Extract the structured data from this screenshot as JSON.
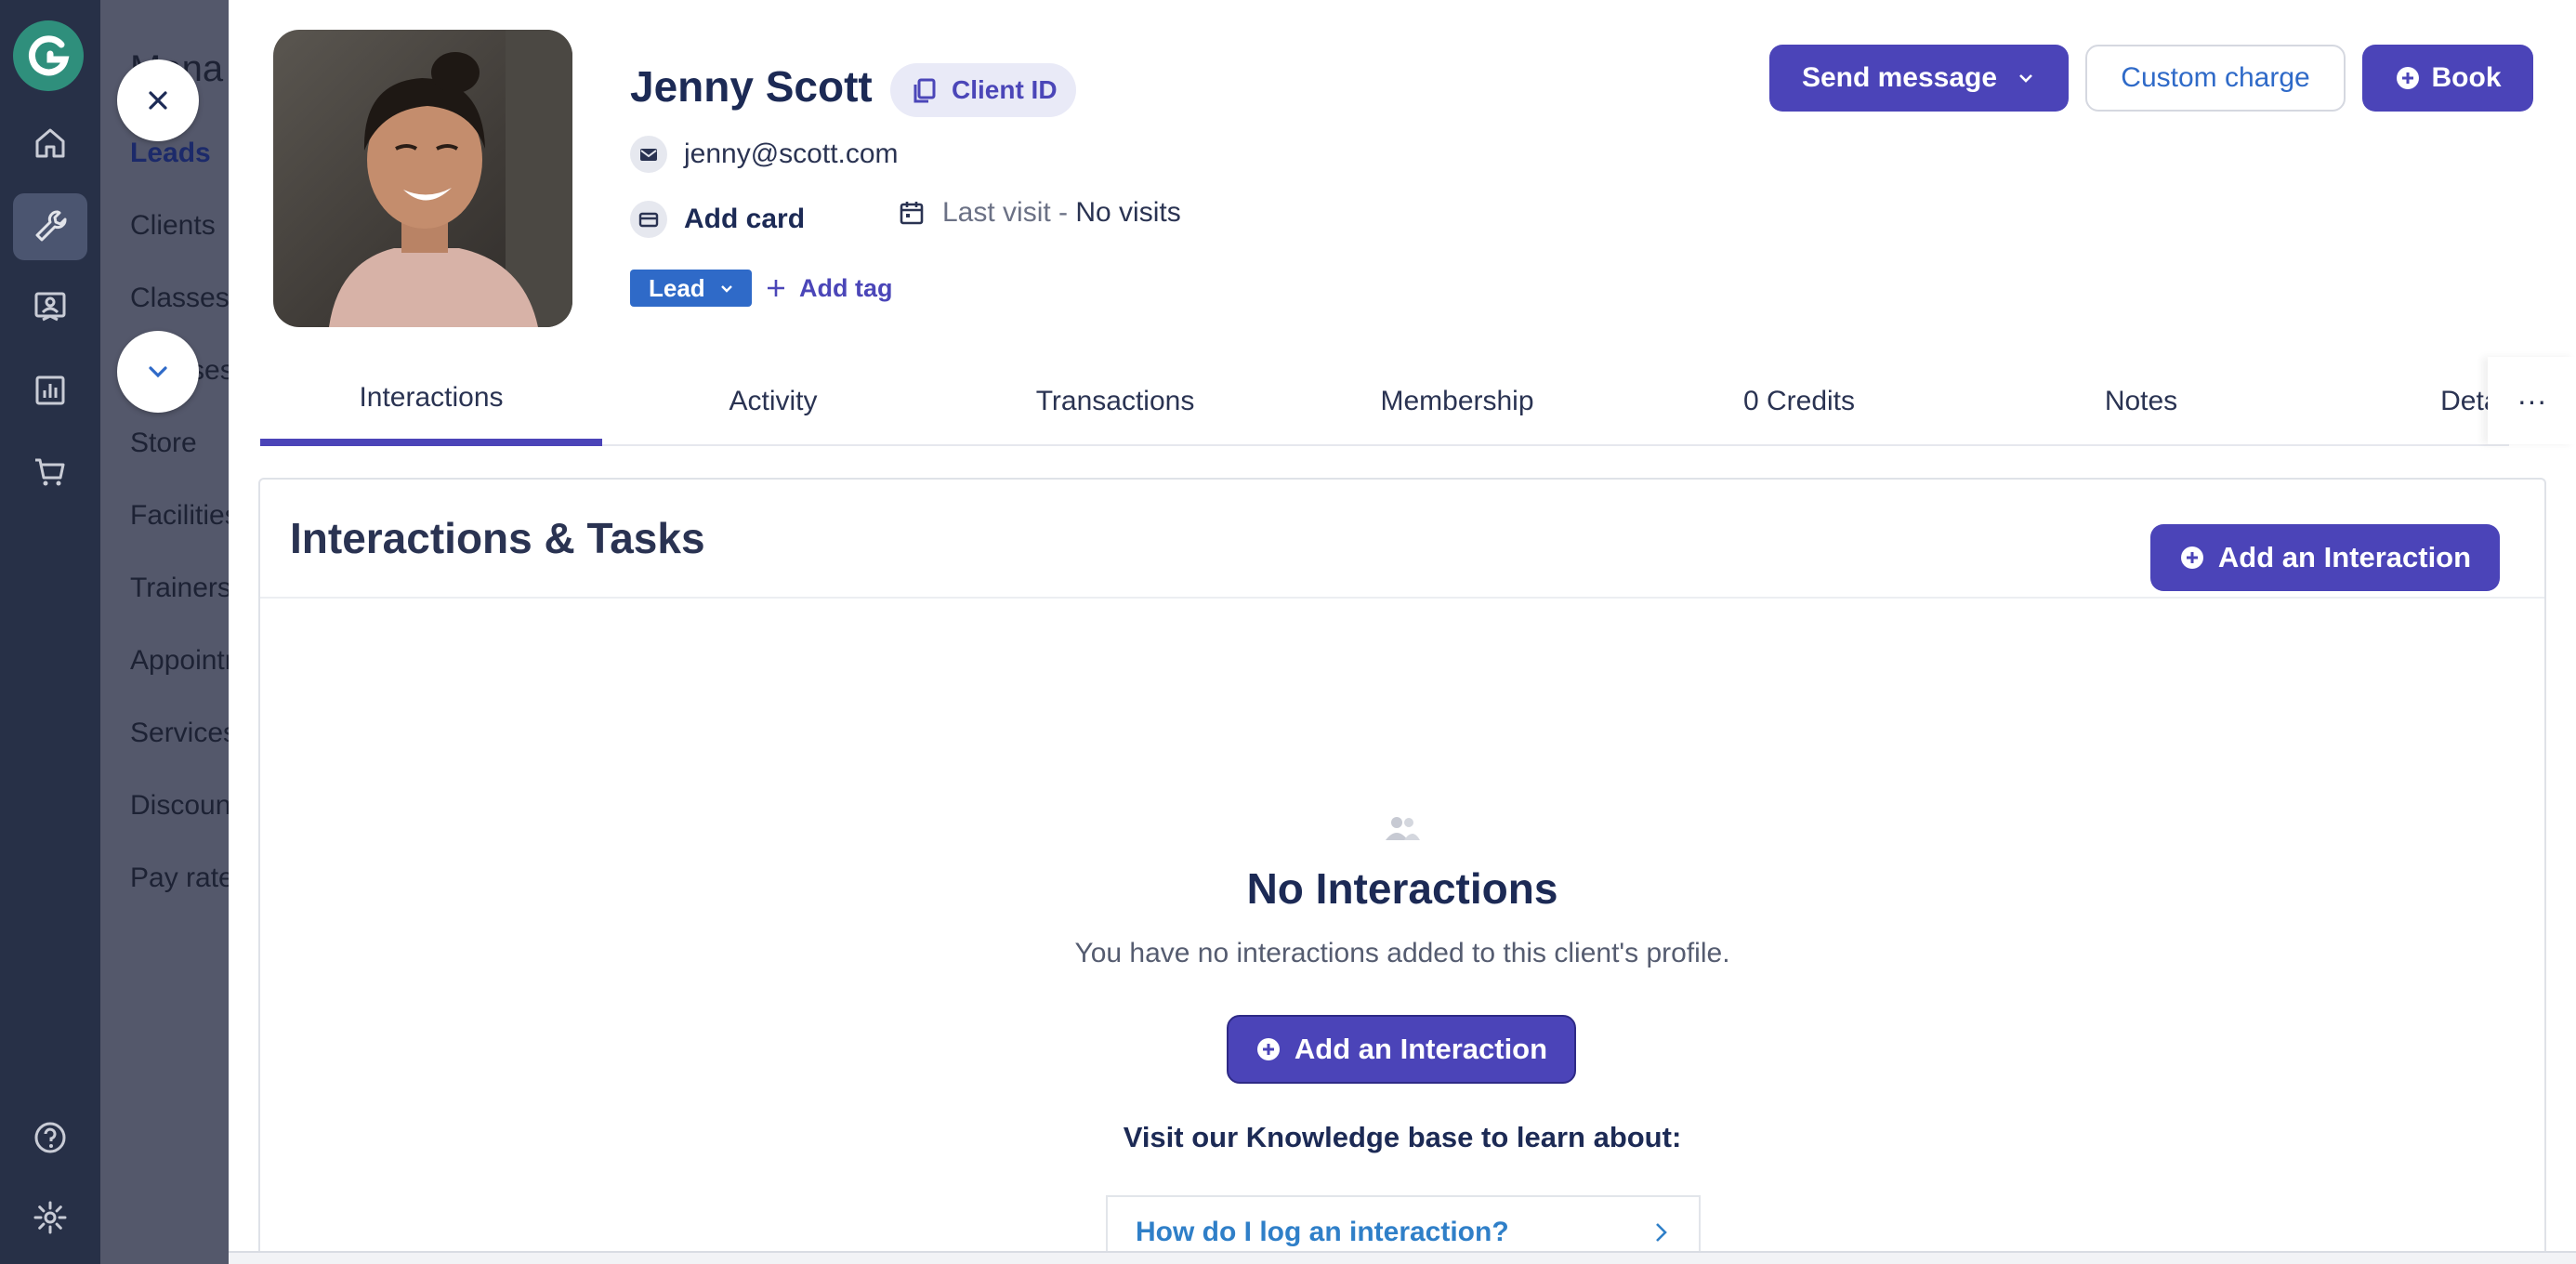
{
  "nav": {
    "subnav_title": "Mana",
    "items": [
      "Leads",
      "Clients",
      "Classes",
      "Courses",
      "Store",
      "Facilities",
      "Trainers",
      "Appointments",
      "Services",
      "Discounts",
      "Pay rates"
    ]
  },
  "client": {
    "name": "Jenny Scott",
    "client_id_label": "Client ID",
    "email": "jenny@scott.com",
    "add_card": "Add card",
    "last_visit_label": "Last visit - ",
    "last_visit_value": "No visits",
    "tag": "Lead",
    "add_tag": "Add tag"
  },
  "actions": {
    "send_message": "Send message",
    "custom_charge": "Custom charge",
    "book": "Book"
  },
  "tabs": [
    "Interactions",
    "Activity",
    "Transactions",
    "Membership",
    "0 Credits",
    "Notes",
    "Details"
  ],
  "tab_more": "···",
  "section": {
    "title": "Interactions & Tasks",
    "add_button": "Add an Interaction"
  },
  "empty_state": {
    "title": "No Interactions",
    "subtitle": "You have no interactions added to this client's profile.",
    "button": "Add an Interaction",
    "kb_title": "Visit our Knowledge base to learn about:",
    "kb_link": "How do I log an interaction?"
  },
  "colors": {
    "primary": "#4b44b8",
    "link": "#2f6ac8",
    "brand": "#2f8f7c"
  }
}
